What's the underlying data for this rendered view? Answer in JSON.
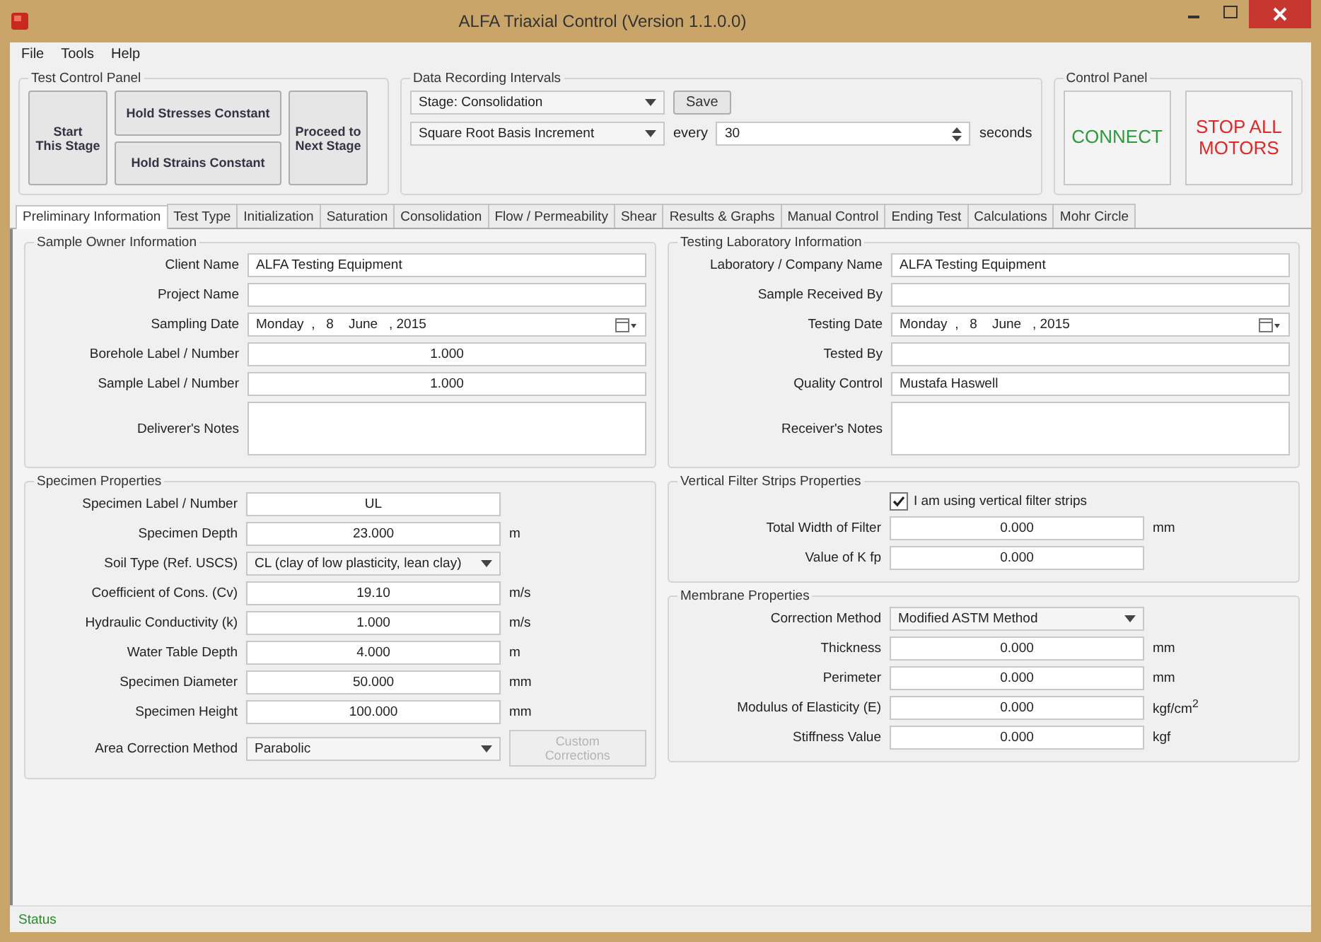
{
  "window": {
    "title": "ALFA Triaxial Control (Version 1.1.0.0)"
  },
  "menu": [
    "File",
    "Tools",
    "Help"
  ],
  "test_control": {
    "title": "Test Control Panel",
    "start": "Start\nThis Stage",
    "hold": [
      "Hold Stresses Constant",
      "Hold Strains Constant"
    ],
    "proceed": "Proceed to\nNext Stage"
  },
  "data_recording": {
    "title": "Data Recording Intervals",
    "stage_select": "Stage: Consolidation",
    "save": "Save",
    "interval_select": "Square Root Basis Increment",
    "every": "every",
    "every_value": "30",
    "seconds": "seconds"
  },
  "control_panel": {
    "title": "Control Panel",
    "connect": "CONNECT",
    "stop": "STOP ALL\nMOTORS"
  },
  "tabs": [
    {
      "label": "Preliminary Information",
      "selected": true
    },
    {
      "label": "Test Type",
      "selected": false
    },
    {
      "label": "Initialization",
      "selected": false
    },
    {
      "label": "Saturation",
      "selected": false
    },
    {
      "label": "Consolidation",
      "selected": false
    },
    {
      "label": "Flow / Permeability",
      "selected": false
    },
    {
      "label": "Shear",
      "selected": false
    },
    {
      "label": "Results & Graphs",
      "selected": false
    },
    {
      "label": "Manual Control",
      "selected": false
    },
    {
      "label": "Ending Test",
      "selected": false
    },
    {
      "label": "Calculations",
      "selected": false
    },
    {
      "label": "Mohr Circle",
      "selected": false
    }
  ],
  "sample_owner": {
    "title": "Sample Owner Information",
    "fields": [
      {
        "label": "Client Name",
        "kind": "text",
        "value": "ALFA Testing Equipment"
      },
      {
        "label": "Project Name",
        "kind": "text"
      },
      {
        "label": "Sampling Date",
        "kind": "date",
        "value": "Monday  ,   8    June   , 2015"
      },
      {
        "label": "Borehole Label / Number",
        "kind": "number",
        "value": "1.000"
      },
      {
        "label": "Sample Label / Number",
        "kind": "number",
        "value": "1.000"
      },
      {
        "label": "Deliverer's Notes",
        "kind": "notes"
      }
    ]
  },
  "laboratory": {
    "title": "Testing Laboratory Information",
    "fields": [
      {
        "label": "Laboratory / Company Name",
        "kind": "text",
        "value": "ALFA Testing Equipment"
      },
      {
        "label": "Sample Received By",
        "kind": "text"
      },
      {
        "label": "Testing Date",
        "kind": "date",
        "value": "Monday  ,   8    June   , 2015"
      },
      {
        "label": "Tested By",
        "kind": "text"
      },
      {
        "label": "Quality Control",
        "kind": "text",
        "value": "Mustafa Haswell"
      },
      {
        "label": "Receiver's Notes",
        "kind": "notes"
      }
    ]
  },
  "specimen": {
    "title": "Specimen Properties",
    "fields": [
      {
        "label": "Specimen Label / Number",
        "kind": "number",
        "value": "UL"
      },
      {
        "label": "Specimen Depth",
        "kind": "number",
        "value": "23.000",
        "unit": "m"
      },
      {
        "label": "Soil Type (Ref. USCS)",
        "kind": "select",
        "value": "CL (clay of low plasticity, lean clay)"
      },
      {
        "label": "Coefficient of Cons. (Cv)",
        "kind": "number",
        "value": "19.10",
        "unit": "m/s"
      },
      {
        "label": "Hydraulic Conductivity (k)",
        "kind": "number",
        "value": "1.000",
        "unit": "m/s"
      },
      {
        "label": "Water Table Depth",
        "kind": "number",
        "value": "4.000",
        "unit": "m"
      },
      {
        "label": "Specimen Diameter",
        "kind": "number",
        "value": "50.000",
        "unit": "mm"
      },
      {
        "label": "Specimen Height",
        "kind": "number",
        "value": "100.000",
        "unit": "mm"
      },
      {
        "label": "Area Correction Method",
        "kind": "select",
        "value": "Parabolic",
        "button": {
          "label": "Custom Corrections",
          "disabled": true
        }
      }
    ]
  },
  "filter_strips": {
    "title": "Vertical Filter Strips Properties",
    "checkbox": {
      "label": "I am using vertical filter strips",
      "checked": true
    },
    "fields": [
      {
        "label": "Total Width of Filter",
        "kind": "number",
        "value": "0.000",
        "unit": "mm"
      },
      {
        "label": "Value of K fp",
        "kind": "number",
        "value": "0.000"
      }
    ]
  },
  "membrane": {
    "title": "Membrane Properties",
    "fields": [
      {
        "label": "Correction Method",
        "kind": "select",
        "value": "Modified ASTM Method"
      },
      {
        "label": "Thickness",
        "kind": "number",
        "value": "0.000",
        "unit": "mm"
      },
      {
        "label": "Perimeter",
        "kind": "number",
        "value": "0.000",
        "unit": "mm"
      },
      {
        "label": "Modulus of Elasticity (E)",
        "kind": "number",
        "value": "0.000",
        "unit": "kgf/cm$^{2}$"
      },
      {
        "label": "Stiffness Value",
        "kind": "number",
        "value": "0.000",
        "unit": "kgf"
      }
    ]
  },
  "status_bar": "Status"
}
